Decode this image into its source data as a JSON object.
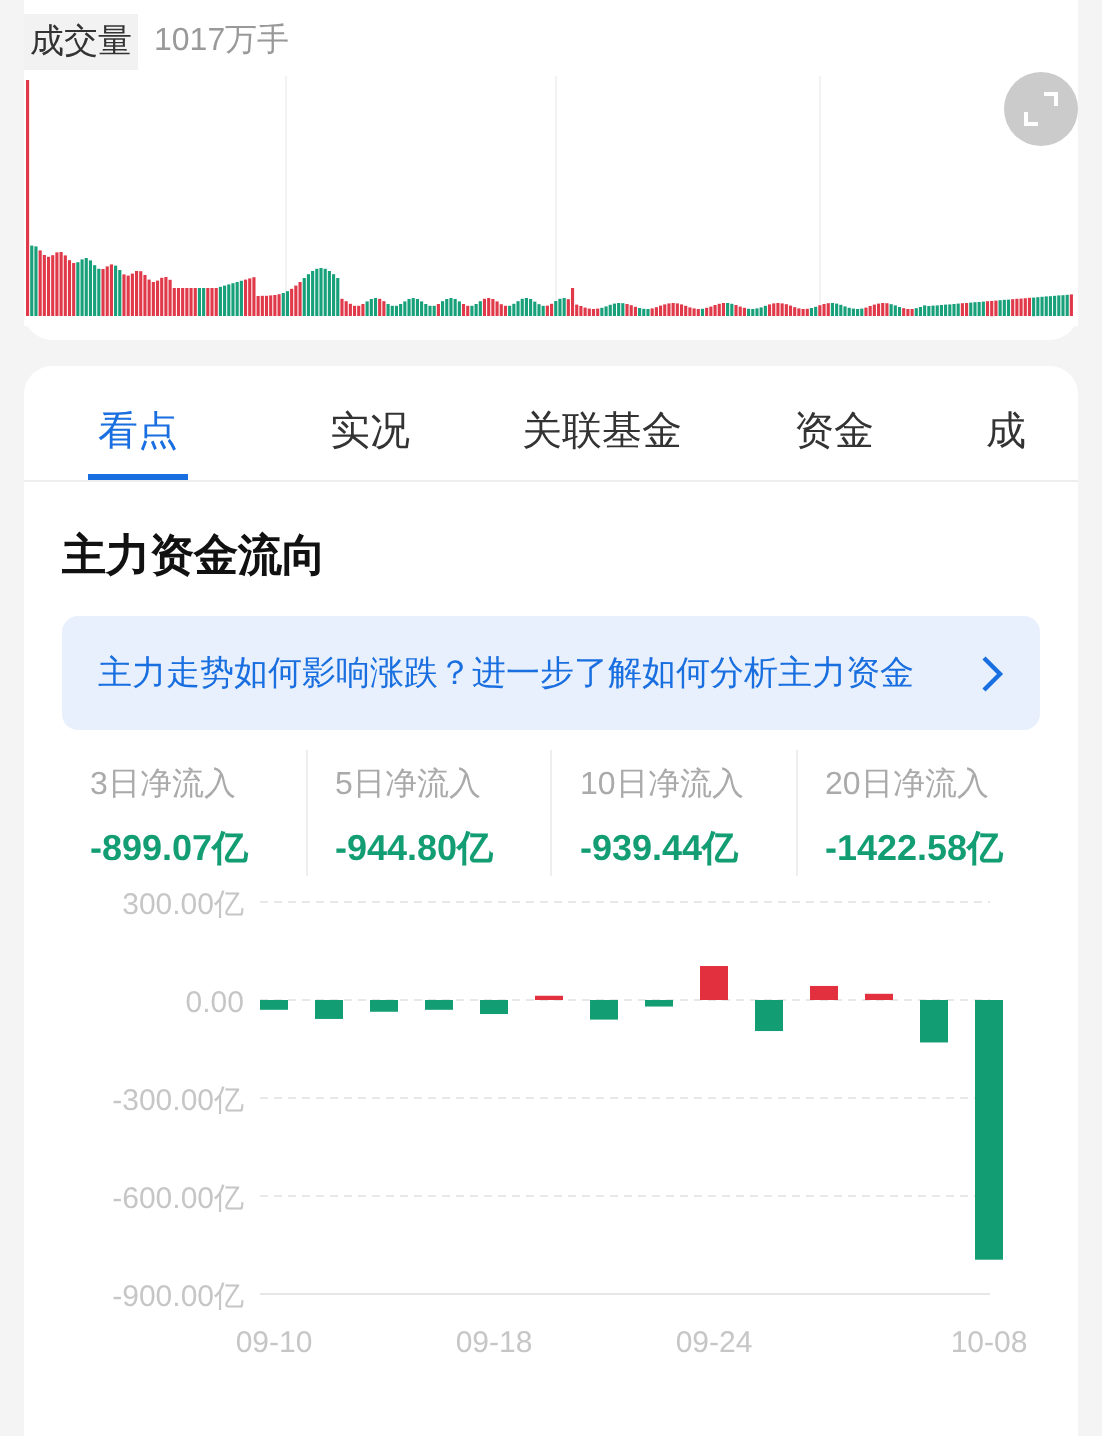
{
  "volume": {
    "label": "成交量",
    "value": "1017万手"
  },
  "tabs": [
    {
      "label": "看点",
      "selected": true
    },
    {
      "label": "实况",
      "selected": false
    },
    {
      "label": "关联基金",
      "selected": false
    },
    {
      "label": "资金",
      "selected": false
    },
    {
      "label": "成",
      "selected": false
    }
  ],
  "section_title": "主力资金流向",
  "banner": {
    "text": "主力走势如何影响涨跌？进一步了解如何分析主力资金"
  },
  "stats": [
    {
      "label": "3日净流入",
      "value": "-899.07亿"
    },
    {
      "label": "5日净流入",
      "value": "-944.80亿"
    },
    {
      "label": "10日净流入",
      "value": "-939.44亿"
    },
    {
      "label": "20日净流入",
      "value": "-1422.58亿"
    }
  ],
  "chart_data": {
    "type": "bar",
    "grid": true,
    "categories": [
      "09-10",
      null,
      null,
      null,
      "09-18",
      null,
      null,
      null,
      "09-24",
      null,
      null,
      null,
      null,
      "10-08"
    ],
    "values": [
      -30,
      -58,
      -36,
      -30,
      -43,
      13,
      -60,
      -20,
      104,
      -95,
      43,
      19,
      -130,
      -795
    ],
    "ylim": [
      -900,
      300
    ],
    "yticks": [
      {
        "value": 300,
        "label": "300.00亿"
      },
      {
        "value": 0,
        "label": "0.00"
      },
      {
        "value": -300,
        "label": "-300.00亿"
      },
      {
        "value": -600,
        "label": "-600.00亿"
      },
      {
        "value": -900,
        "label": "-900.00亿"
      }
    ]
  }
}
